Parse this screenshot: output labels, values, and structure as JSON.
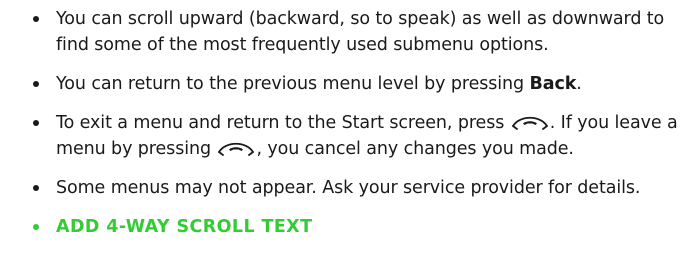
{
  "bullets": [
    {
      "text": "You can scroll upward (backward, so to speak) as well as downward to find some of the most frequently used submenu options."
    },
    {
      "pre": "You can return to the previous menu level by pressing ",
      "bold": "Back",
      "post": "."
    },
    {
      "pre": "To exit a menu and return to the Start screen, press ",
      "mid": ". If you leave a menu by pressing ",
      "post": ", you cancel any changes you made.",
      "icon": "end-call-key-icon"
    },
    {
      "text": "Some menus may not appear. Ask your service provider for details."
    },
    {
      "text": "ADD 4-WAY SCROLL TEXT",
      "color": "#33cc33"
    }
  ]
}
